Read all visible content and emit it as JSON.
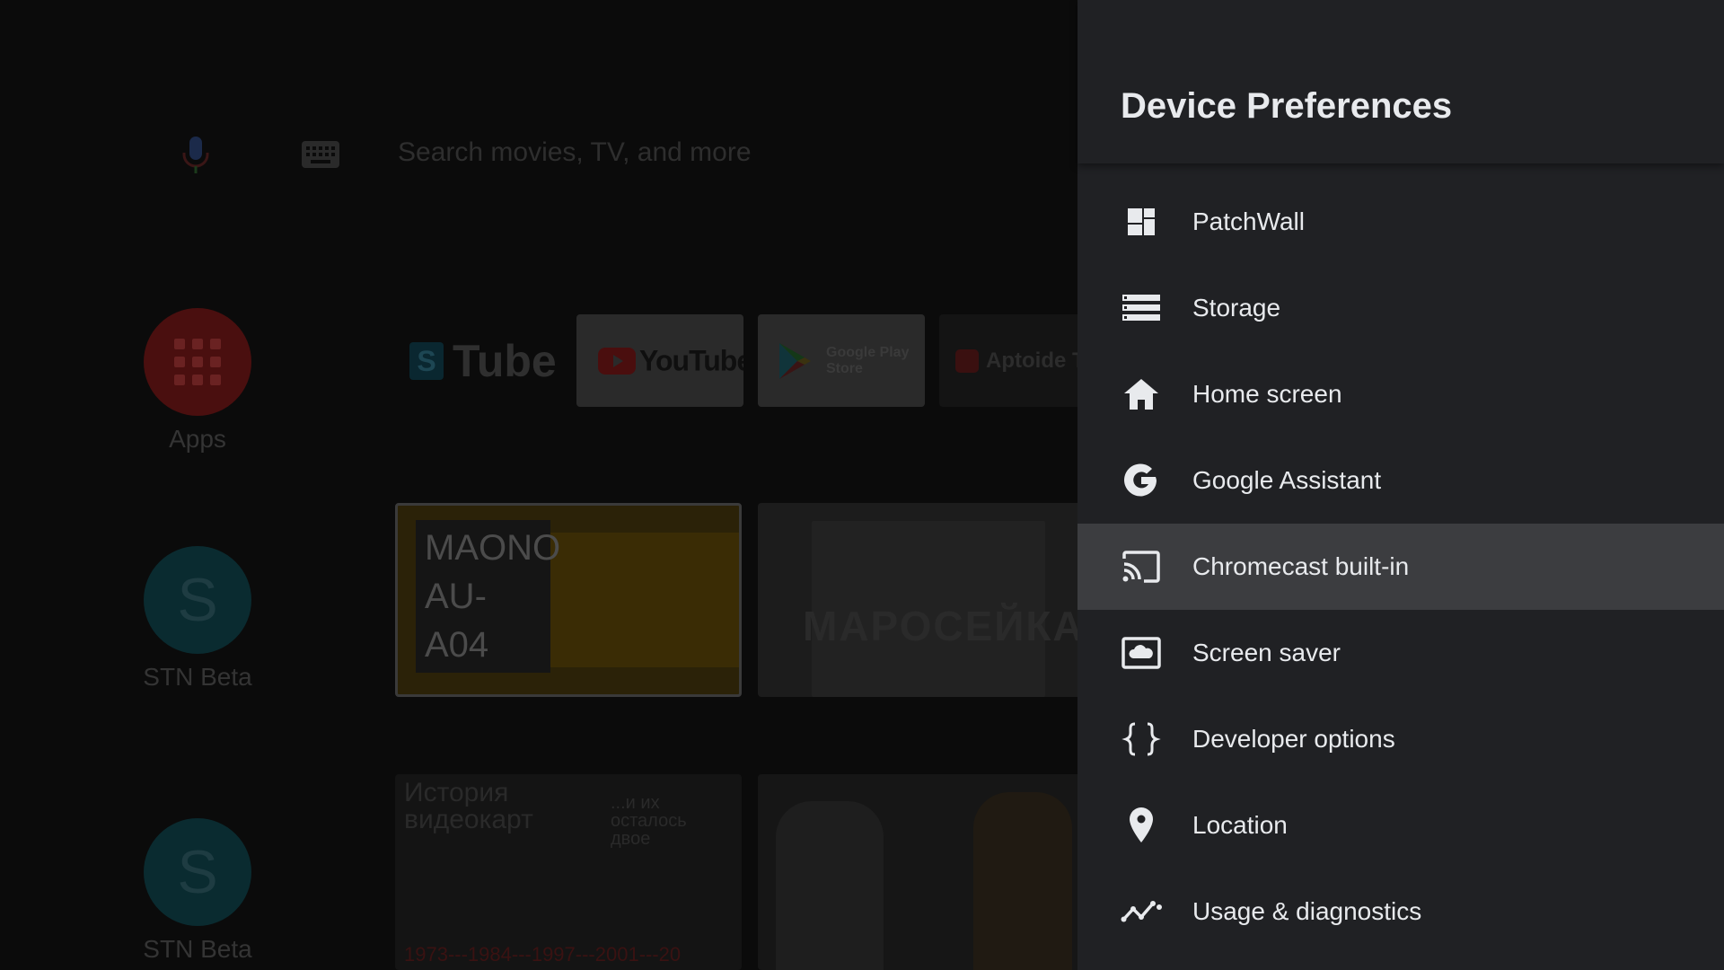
{
  "home": {
    "search": {
      "placeholder": "Search movies, TV, and more"
    },
    "side_apps": [
      {
        "label": "Apps",
        "icon": "apps-grid-icon"
      },
      {
        "label": "STN Beta",
        "letter": "S"
      },
      {
        "label": "STN Beta",
        "letter": "S"
      }
    ],
    "tiles": {
      "stube_letter": "S",
      "stube_text": "Tube",
      "youtube": "YouTube",
      "play_line1": "Google Play",
      "play_line2": "Store",
      "aptoide": "Aptoide T"
    },
    "cards": {
      "maono_line1": "MAONO",
      "maono_line2": "AU-A04",
      "maro": "МАРОСЕЙКА",
      "hist_line1": "История",
      "hist_line2": "видеокарт",
      "hist_sub1": "...и их",
      "hist_sub2": "осталось",
      "hist_sub3": "двое",
      "hist_years": "1973---1984---1997---2001---20"
    }
  },
  "panel": {
    "title": "Device Preferences",
    "items": [
      {
        "label": "PatchWall",
        "icon": "patchwall-icon",
        "focused": false
      },
      {
        "label": "Storage",
        "icon": "storage-icon",
        "focused": false
      },
      {
        "label": "Home screen",
        "icon": "home-icon",
        "focused": false
      },
      {
        "label": "Google Assistant",
        "icon": "google-g-icon",
        "focused": false
      },
      {
        "label": "Chromecast built-in",
        "icon": "cast-icon",
        "focused": true
      },
      {
        "label": "Screen saver",
        "icon": "screensaver-icon",
        "focused": false
      },
      {
        "label": "Developer options",
        "icon": "braces-icon",
        "focused": false
      },
      {
        "label": "Location",
        "icon": "location-pin-icon",
        "focused": false
      },
      {
        "label": "Usage & diagnostics",
        "icon": "usage-diagnostics-icon",
        "focused": false
      }
    ]
  },
  "colors": {
    "panel_bg": "#202124",
    "focused_bg": "#3c3d40",
    "text": "#e8eaed"
  }
}
